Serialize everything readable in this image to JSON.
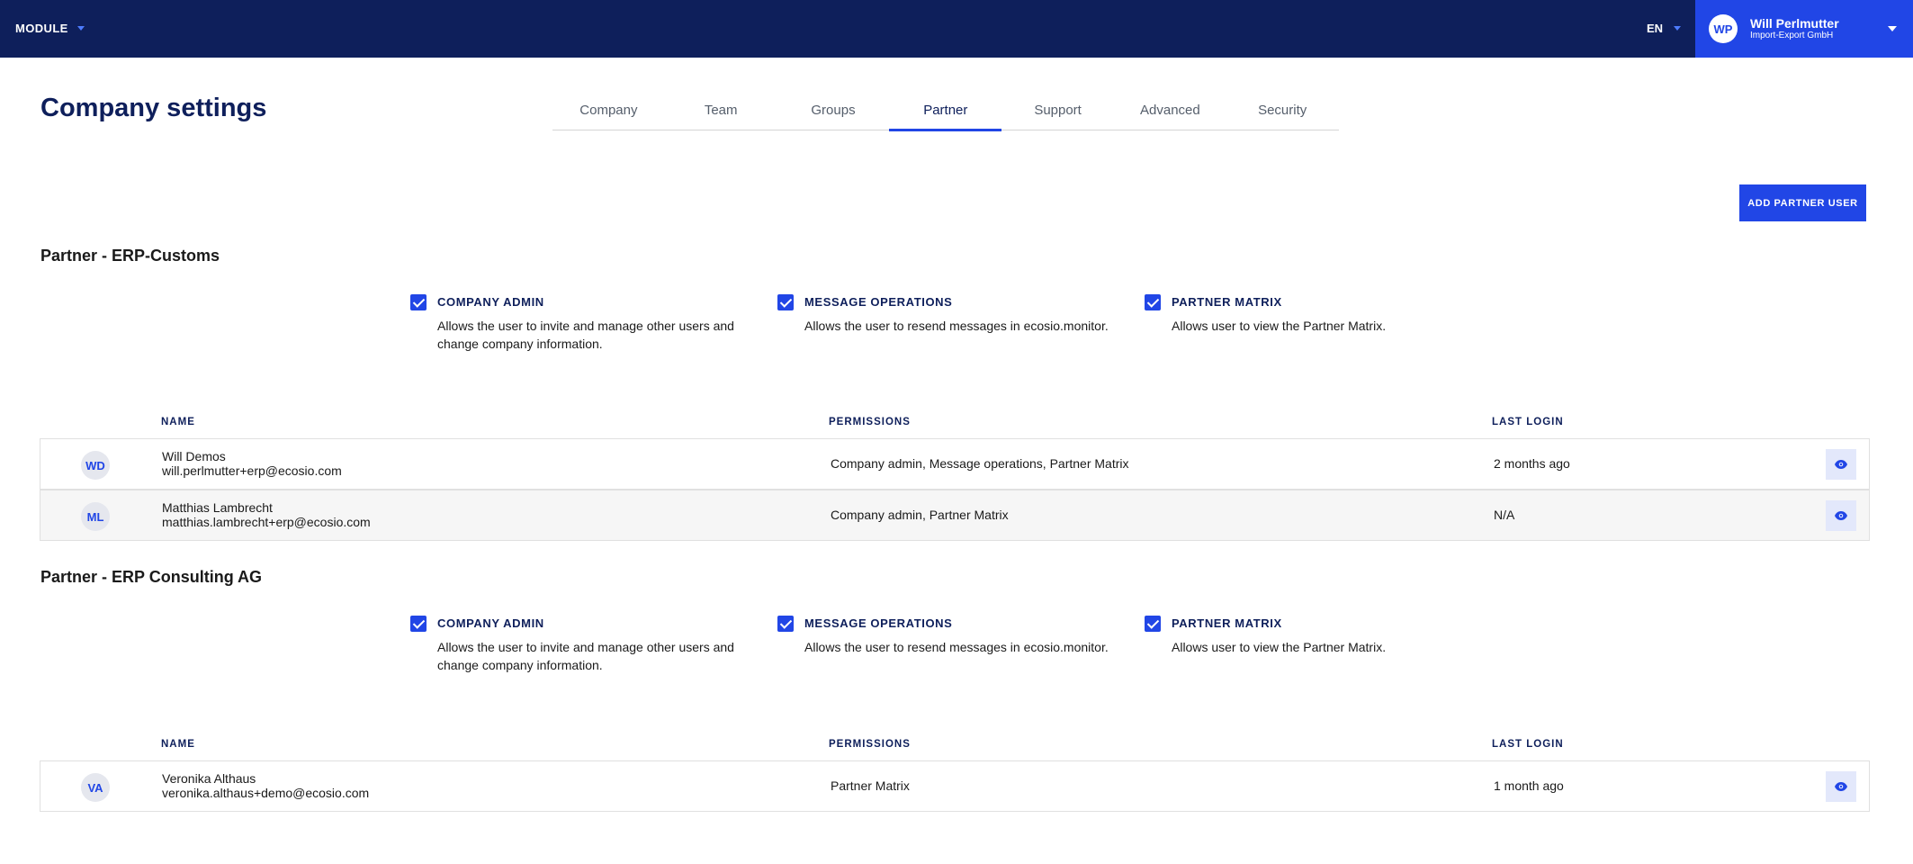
{
  "topbar": {
    "module_label": "MODULE",
    "language": "EN",
    "user": {
      "initials": "WP",
      "name": "Will Perlmutter",
      "company": "Import-Export GmbH"
    }
  },
  "page_title": "Company settings",
  "tabs": [
    {
      "label": "Company"
    },
    {
      "label": "Team"
    },
    {
      "label": "Groups"
    },
    {
      "label": "Partner",
      "active": true
    },
    {
      "label": "Support"
    },
    {
      "label": "Advanced"
    },
    {
      "label": "Security"
    }
  ],
  "add_button_label": "ADD PARTNER USER",
  "columns": {
    "name": "NAME",
    "permissions": "PERMISSIONS",
    "last_login": "LAST LOGIN"
  },
  "partners": [
    {
      "title": "Partner - ERP-Customs",
      "permissions": [
        {
          "title": "COMPANY ADMIN",
          "desc": "Allows the user to invite and manage other users and change company information.",
          "checked": true
        },
        {
          "title": "MESSAGE OPERATIONS",
          "desc": "Allows the user to resend messages in ecosio.monitor.",
          "checked": true
        },
        {
          "title": "PARTNER MATRIX",
          "desc": "Allows user to view the Partner Matrix.",
          "checked": true
        }
      ],
      "users": [
        {
          "initials": "WD",
          "name": "Will Demos",
          "email": "will.perlmutter+erp@ecosio.com",
          "permissions": "Company admin, Message operations, Partner Matrix",
          "last_login": "2 months ago"
        },
        {
          "initials": "ML",
          "name": "Matthias Lambrecht",
          "email": "matthias.lambrecht+erp@ecosio.com",
          "permissions": "Company admin, Partner Matrix",
          "last_login": "N/A"
        }
      ]
    },
    {
      "title": "Partner - ERP Consulting AG",
      "permissions": [
        {
          "title": "COMPANY ADMIN",
          "desc": "Allows the user to invite and manage other users and change company information.",
          "checked": true
        },
        {
          "title": "MESSAGE OPERATIONS",
          "desc": "Allows the user to resend messages in ecosio.monitor.",
          "checked": true
        },
        {
          "title": "PARTNER MATRIX",
          "desc": "Allows user to view the Partner Matrix.",
          "checked": true
        }
      ],
      "users": [
        {
          "initials": "VA",
          "name": "Veronika Althaus",
          "email": "veronika.althaus+demo@ecosio.com",
          "permissions": "Partner Matrix",
          "last_login": "1 month ago"
        }
      ]
    }
  ]
}
